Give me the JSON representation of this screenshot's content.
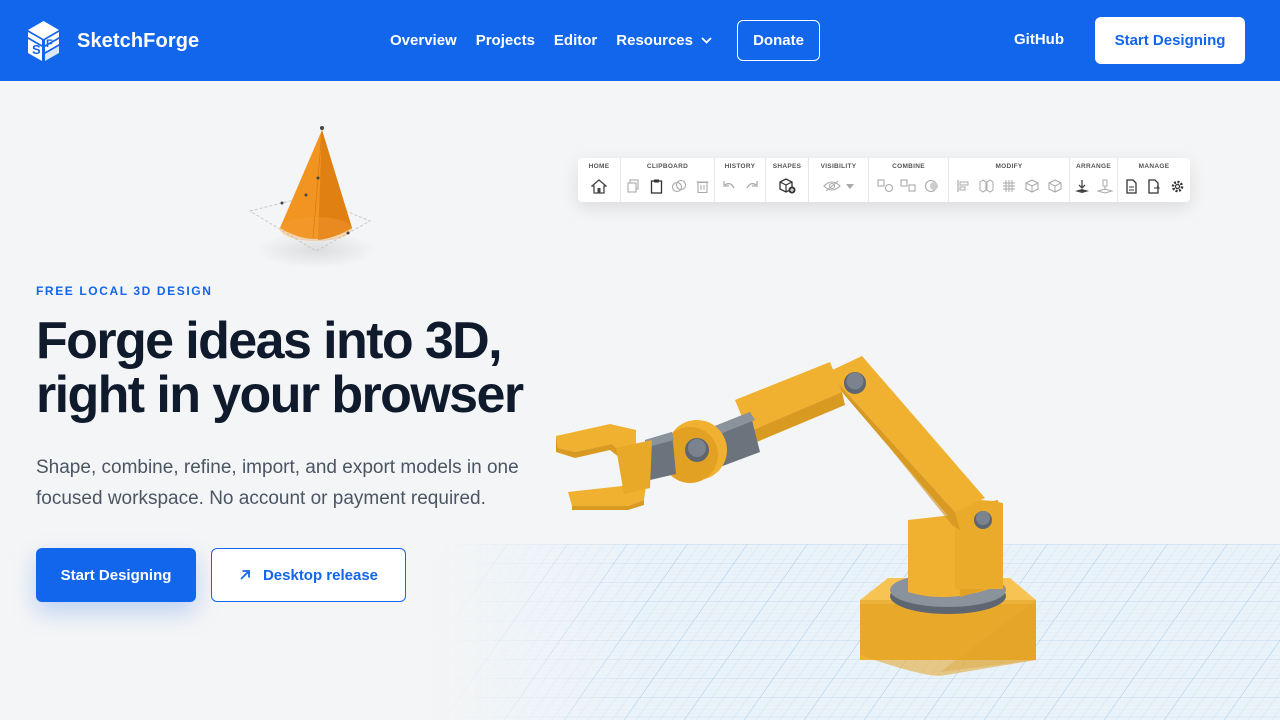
{
  "brand": {
    "name": "SketchForge",
    "colors": {
      "primary": "#1266ec",
      "text_dark": "#0f1b2d",
      "muted": "#4b5563",
      "robot_yellow": "#f0b030",
      "cone_orange": "#f29420"
    }
  },
  "nav": {
    "links": [
      "Overview",
      "Projects",
      "Editor",
      "Resources"
    ],
    "resources_icon": "chevron-down-icon",
    "donate": "Donate",
    "github": "GitHub",
    "cta": "Start Designing"
  },
  "hero": {
    "eyebrow": "FREE LOCAL 3D DESIGN",
    "headline_line1": "Forge ideas into 3D,",
    "headline_line2": "right in your browser",
    "sub_line1": "Shape, combine, refine, import, and export models in one",
    "sub_line2": "focused workspace. No account or payment required.",
    "primary_cta": "Start Designing",
    "secondary_cta": "Desktop release",
    "secondary_icon": "arrow-up-right-icon"
  },
  "toolbar": {
    "groups": [
      {
        "label": "HOME",
        "icons": [
          "home-icon"
        ]
      },
      {
        "label": "CLIPBOARD",
        "icons": [
          "copy-icon",
          "paste-icon",
          "duplicate-icon",
          "delete-icon"
        ]
      },
      {
        "label": "HISTORY",
        "icons": [
          "undo-icon",
          "redo-icon"
        ]
      },
      {
        "label": "SHAPES",
        "icons": [
          "add-shape-icon"
        ]
      },
      {
        "label": "VISIBILITY",
        "icons": [
          "eye-off-icon",
          "dropdown-icon"
        ]
      },
      {
        "label": "COMBINE",
        "icons": [
          "group-icon",
          "ungroup-icon",
          "subtract-icon"
        ]
      },
      {
        "label": "MODIFY",
        "icons": [
          "align-icon",
          "mirror-icon",
          "grid-icon",
          "cube-icon",
          "wireframe-icon"
        ]
      },
      {
        "label": "ARRANGE",
        "icons": [
          "drop-to-plane-icon",
          "lift-icon"
        ]
      },
      {
        "label": "MANAGE",
        "icons": [
          "import-icon",
          "export-icon",
          "settings-icon"
        ]
      }
    ]
  }
}
